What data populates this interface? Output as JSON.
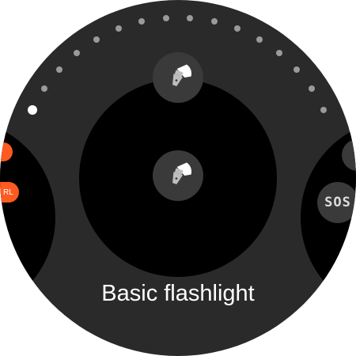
{
  "pager": {
    "count": 16,
    "active_index": 0
  },
  "left_card": {
    "header": "",
    "pill_top": "",
    "pill_bottom": "RL",
    "accent_color": "#ff5a1f"
  },
  "center_card": {
    "icon": "flashlight-icon",
    "title": "Basic flashlight"
  },
  "top_icon": "flashlight-icon",
  "right_card": {
    "header": "",
    "icon": "flashlight-icon",
    "sos_label": "SOS"
  }
}
